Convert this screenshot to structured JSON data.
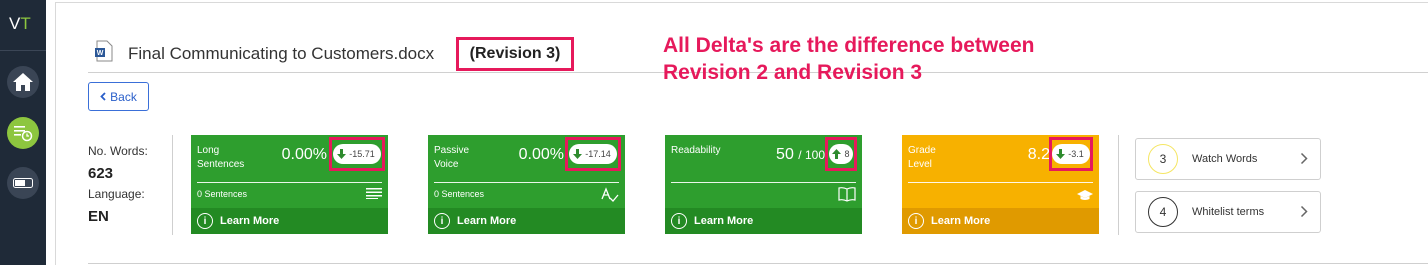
{
  "app": {
    "logo_v": "V",
    "logo_t": "T"
  },
  "document": {
    "title": "Final Communicating to Customers.docx",
    "revision": "(Revision 3)"
  },
  "annotation": {
    "line1": "All Delta's are the difference between",
    "line2": "Revision 2 and Revision 3"
  },
  "back_label": "Back",
  "stats": {
    "words_label": "No. Words:",
    "words_value": "623",
    "language_label": "Language:",
    "language_value": "EN"
  },
  "cards": [
    {
      "name_line1": "Long",
      "name_line2": "Sentences",
      "value": "0.00%",
      "delta": "-15.71",
      "delta_direction": "down",
      "footer_label": "0 Sentences",
      "icon": "lines-icon",
      "learn_more": "Learn More",
      "color": "#2e9e2e"
    },
    {
      "name_line1": "Passive",
      "name_line2": "Voice",
      "value": "0.00%",
      "delta": "-17.14",
      "delta_direction": "down",
      "footer_label": "0 Sentences",
      "icon": "spellcheck-icon",
      "learn_more": "Learn More",
      "color": "#2e9e2e"
    },
    {
      "name_line1": "Readability",
      "name_line2": "",
      "value": "50",
      "value_suffix": "/ 100",
      "delta": "8",
      "delta_direction": "up",
      "footer_label": "",
      "icon": "book-icon",
      "learn_more": "Learn More",
      "color": "#2e9e2e"
    },
    {
      "name_line1": "Grade",
      "name_line2": "Level",
      "value": "8.2",
      "delta": "-3.1",
      "delta_direction": "down",
      "footer_label": "",
      "icon": "graduation-cap-icon",
      "learn_more": "Learn More",
      "color": "#f7b100"
    }
  ],
  "side_cards": [
    {
      "number": "3",
      "label": "Watch Words",
      "ring_color": "#f5e663"
    },
    {
      "number": "4",
      "label": "Whitelist terms",
      "ring_color": "#333333"
    }
  ],
  "colors": {
    "highlight": "#e6195b",
    "green": "#2e9e2e",
    "yellow": "#f7b100",
    "sidebar": "#1f2a38",
    "accent_green": "#8dc63f"
  }
}
